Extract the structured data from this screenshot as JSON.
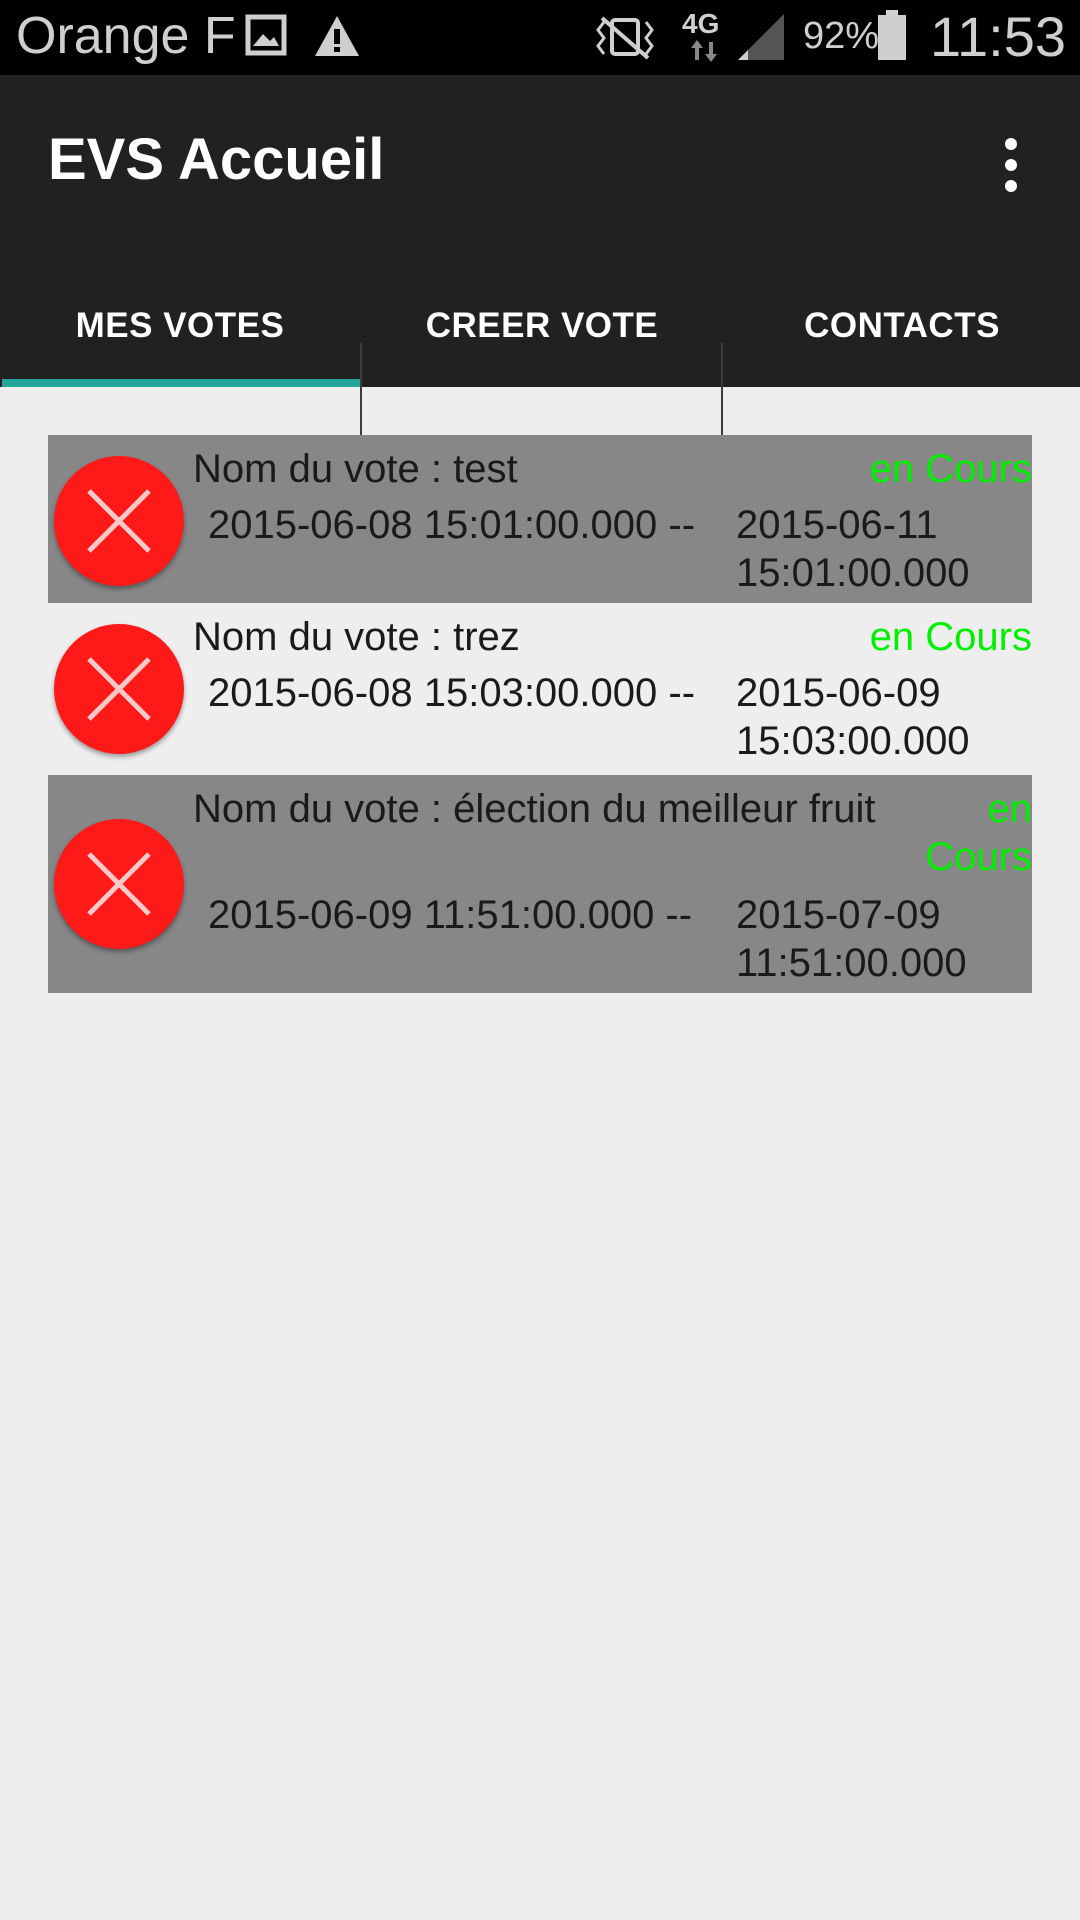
{
  "status_bar": {
    "carrier": "Orange F",
    "network": "4G",
    "battery": "92%",
    "time": "11:53",
    "icons": [
      "image-icon",
      "warning-icon",
      "vibrate-icon",
      "signal-icon",
      "battery-icon"
    ]
  },
  "app_bar": {
    "title": "EVS Accueil",
    "overflow_icon": "more-vert-icon"
  },
  "tabs": [
    {
      "label": "MES VOTES",
      "selected": true
    },
    {
      "label": "CREER VOTE",
      "selected": false
    },
    {
      "label": "CONTACTS",
      "selected": false
    }
  ],
  "colors": {
    "accent": "#26a69a",
    "status_green": "#00ee00",
    "delete_red": "#ff1a1a",
    "row_grey": "#878787",
    "appbar": "#212121"
  },
  "votes": [
    {
      "name": "Nom du vote :  test",
      "status": "en Cours",
      "start": "2015-06-08 15:01:00.000 --",
      "end_date": "2015-06-11",
      "end_time": "15:01:00.000",
      "delete_icon": "delete-x-icon"
    },
    {
      "name": "Nom du vote :  trez",
      "status": "en Cours",
      "start": "2015-06-08 15:03:00.000 --",
      "end_date": "2015-06-09",
      "end_time": "15:03:00.000",
      "delete_icon": "delete-x-icon"
    },
    {
      "name": "Nom du vote :  élection du meilleur fruit",
      "status_line1": "en",
      "status_line2": "Cours",
      "start": "2015-06-09 11:51:00.000 --",
      "end_date": "2015-07-09",
      "end_time": "11:51:00.000",
      "delete_icon": "delete-x-icon"
    }
  ]
}
